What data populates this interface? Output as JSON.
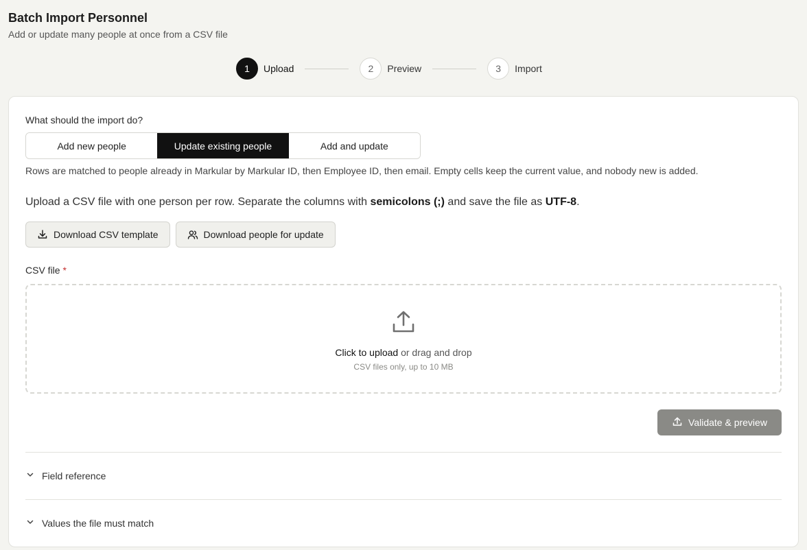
{
  "header": {
    "title": "Batch Import Personnel",
    "subtitle": "Add or update many people at once from a CSV file"
  },
  "stepper": {
    "steps": [
      {
        "number": "1",
        "label": "Upload",
        "active": true
      },
      {
        "number": "2",
        "label": "Preview",
        "active": false
      },
      {
        "number": "3",
        "label": "Import",
        "active": false
      }
    ]
  },
  "mode": {
    "question": "What should the import do?",
    "options": [
      "Add new people",
      "Update existing people",
      "Add and update"
    ],
    "selected": "Update existing people",
    "description": "Rows are matched to people already in Markular by Markular ID, then Employee ID, then email. Empty cells keep the current value, and nobody new is added."
  },
  "instruction": {
    "prefix": "Upload a CSV file with one person per row. Separate the columns with ",
    "bold1": "semicolons (;)",
    "middle": " and save the file as ",
    "bold2": "UTF-8",
    "suffix": "."
  },
  "buttons": {
    "download_template": "Download CSV template",
    "download_people": "Download people for update",
    "validate": "Validate & preview"
  },
  "upload": {
    "label": "CSV file",
    "required_mark": "*",
    "click_text": "Click to upload",
    "drag_text": " or drag and drop",
    "hint": "CSV files only, up to 10 MB"
  },
  "accordions": {
    "field_reference": "Field reference",
    "values_match": "Values the file must match"
  },
  "colors": {
    "background": "#f4f4f0",
    "accent": "#111111",
    "required": "#c53030",
    "disabled_button": "#8a8a86"
  }
}
